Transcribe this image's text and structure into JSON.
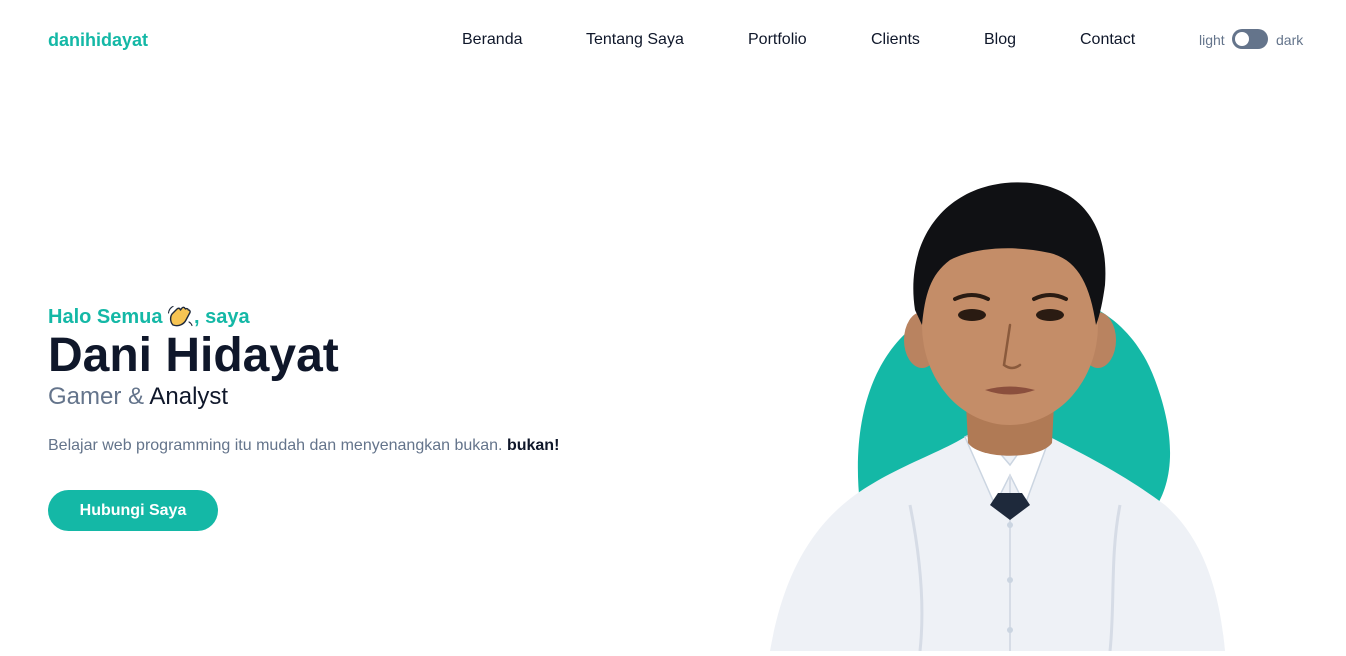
{
  "brand": "danihidayat",
  "nav": {
    "items": [
      {
        "label": "Beranda"
      },
      {
        "label": "Tentang Saya"
      },
      {
        "label": "Portfolio"
      },
      {
        "label": "Clients"
      },
      {
        "label": "Blog"
      },
      {
        "label": "Contact"
      }
    ]
  },
  "theme_toggle": {
    "light_label": "light",
    "dark_label": "dark",
    "current": "light"
  },
  "hero": {
    "greeting_prefix": "Halo Semua",
    "greeting_icon": "waving-hand-icon",
    "greeting_suffix": ", saya",
    "name": "Dani Hidayat",
    "role_primary": "Gamer &",
    "role_secondary": "Analyst",
    "tagline": "Belajar web programming itu mudah dan menyenangkan bukan. ",
    "tagline_bold": "bukan!",
    "cta_label": "Hubungi Saya"
  },
  "colors": {
    "accent": "#14b8a6",
    "text_dark": "#0f172a",
    "text_muted": "#64748b",
    "toggle_track": "#64748b",
    "background": "#ffffff"
  }
}
